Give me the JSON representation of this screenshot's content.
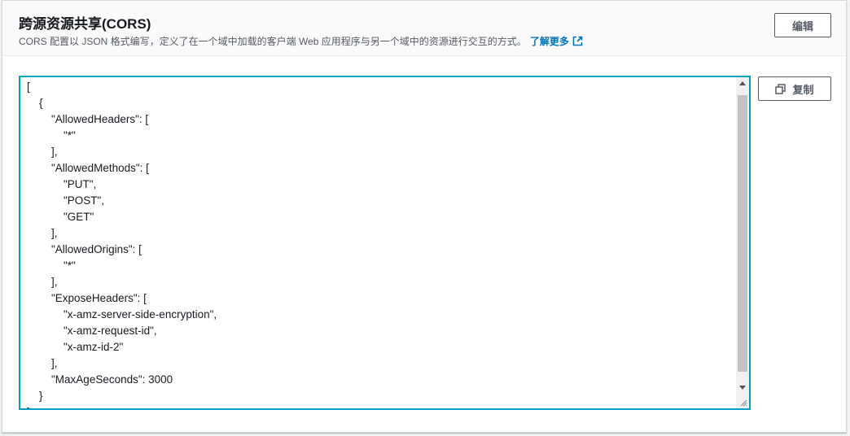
{
  "section": {
    "title": "跨源资源共享(CORS)",
    "description": "CORS 配置以 JSON 格式编写，定义了在一个域中加载的客户端 Web 应用程序与另一个域中的资源进行交互的方式。",
    "learn_more": "了解更多"
  },
  "buttons": {
    "edit": "编辑",
    "copy": "复制"
  },
  "editor": {
    "content": "[\n    {\n        \"AllowedHeaders\": [\n            \"*\"\n        ],\n        \"AllowedMethods\": [\n            \"PUT\",\n            \"POST\",\n            \"GET\"\n        ],\n        \"AllowedOrigins\": [\n            \"*\"\n        ],\n        \"ExposeHeaders\": [\n            \"x-amz-server-side-encryption\",\n            \"x-amz-request-id\",\n            \"x-amz-id-2\"\n        ],\n        \"MaxAgeSeconds\": 3000\n    }\n]"
  },
  "colors": {
    "accent": "#00a1c9",
    "link": "#0073bb"
  },
  "icons": [
    "external-link-icon",
    "copy-icon"
  ]
}
